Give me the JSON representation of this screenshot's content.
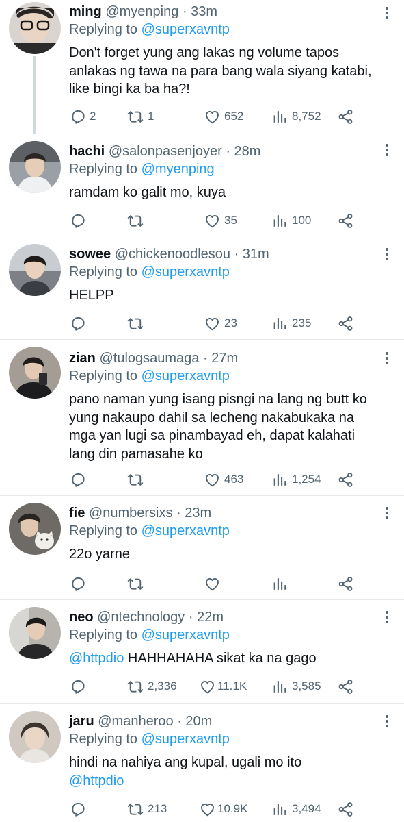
{
  "tweets": [
    {
      "name": "ming",
      "handle": "@myenping",
      "time": "· 33m",
      "replying_prefix": "Replying to",
      "replying_to": "@superxavntp",
      "text": "Don't forget yung ang lakas ng volume tapos anlakas ng tawa na para bang wala siyang katabi, like bingi ka ba ha?!",
      "replies": "2",
      "retweets": "1",
      "likes": "652",
      "views": "8,752"
    },
    {
      "name": "hachi",
      "handle": "@salonpasenjoyer",
      "time": "· 28m",
      "replying_prefix": "Replying to",
      "replying_to": "@myenping",
      "text": "ramdam ko galit mo, kuya",
      "replies": "",
      "retweets": "",
      "likes": "35",
      "views": "100"
    },
    {
      "name": "sowee",
      "handle": "@chickenoodlesou",
      "time": "· 31m",
      "replying_prefix": "Replying to",
      "replying_to": "@superxavntp",
      "text": "HELPP",
      "replies": "",
      "retweets": "",
      "likes": "23",
      "views": "235"
    },
    {
      "name": "zian",
      "handle": "@tulogsaumaga",
      "time": "· 27m",
      "replying_prefix": "Replying to",
      "replying_to": "@superxavntp",
      "text": "pano naman yung isang pisngi na lang ng butt ko yung nakaupo dahil sa lecheng nakabukaka na mga yan lugi sa pinambayad eh, dapat kalahati lang din pamasahe ko",
      "replies": "",
      "retweets": "",
      "likes": "463",
      "views": "1,254"
    },
    {
      "name": "fie",
      "handle": "@numbersixs",
      "time": "· 23m",
      "replying_prefix": "Replying to",
      "replying_to": "@superxavntp",
      "text": "22o yarne",
      "replies": "",
      "retweets": "",
      "likes": "",
      "views": ""
    },
    {
      "name": "neo",
      "handle": "@ntechnology",
      "time": "· 22m",
      "replying_prefix": "Replying to",
      "replying_to": "@superxavntp",
      "mention": "@httpdio",
      "text": "HAHHAHAHA sikat ka na gago",
      "replies": "",
      "retweets": "2,336",
      "likes": "11.1K",
      "views": "3,585"
    },
    {
      "name": "jaru",
      "handle": "@manheroo",
      "time": "· 20m",
      "replying_prefix": "Replying to",
      "replying_to": "@superxavntp",
      "text": "hindi na nahiya ang kupal, ugali mo ito",
      "mention": "@httpdio",
      "replies": "",
      "retweets": "213",
      "likes": "10.9K",
      "views": "3,494"
    }
  ],
  "icons": {
    "reply": "reply-icon",
    "retweet": "retweet-icon",
    "like": "heart-icon",
    "views": "views-icon",
    "share": "share-icon",
    "more": "more-icon"
  },
  "colors": {
    "link": "#1d9bf0",
    "muted": "#536471",
    "text": "#0f1419",
    "divider": "#e7e9ea"
  }
}
